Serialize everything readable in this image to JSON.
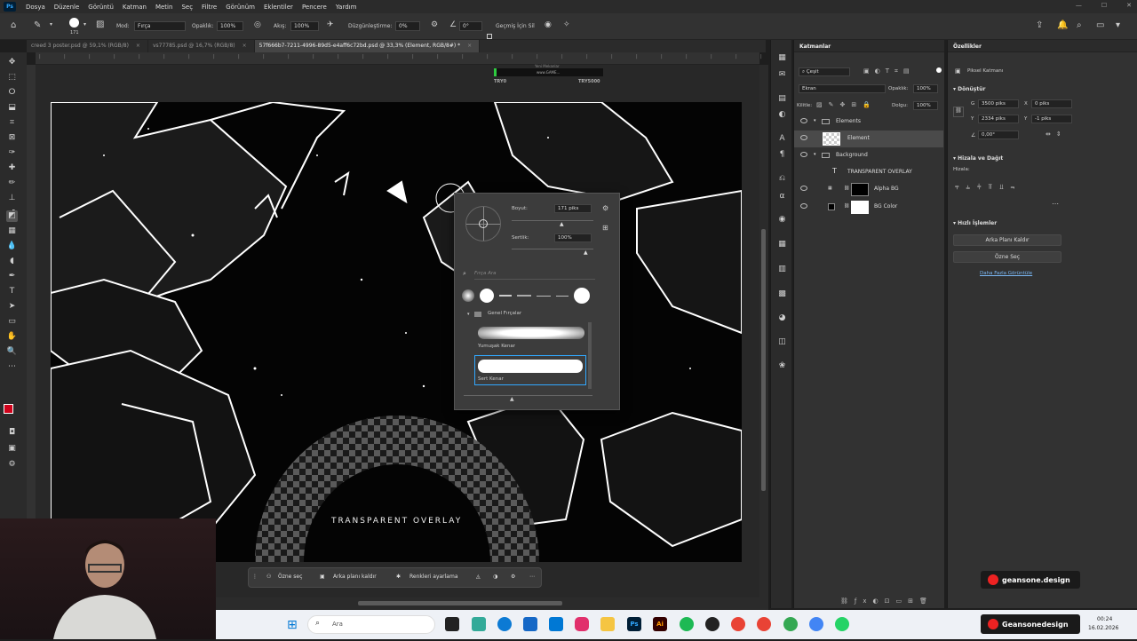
{
  "app": {
    "logo": "Ps"
  },
  "menu": [
    "Dosya",
    "Düzenle",
    "Görüntü",
    "Katman",
    "Metin",
    "Seç",
    "Filtre",
    "Görünüm",
    "Eklentiler",
    "Pencere",
    "Yardım"
  ],
  "options": {
    "brush_size": "171",
    "mode_label": "Mod:",
    "mode_value": "Fırça",
    "opacity_label": "Opaklık:",
    "opacity_value": "100%",
    "flow_label": "Akış:",
    "flow_value": "100%",
    "smoothing_label": "Düzgünleştirme:",
    "smoothing_value": "0%",
    "angle_value": "0°",
    "erase_history_label": "Geçmiş İçin Sil"
  },
  "tabs": [
    {
      "label": "creed 3 poster.psd @ 59,1% (RGB/8)",
      "close": "×"
    },
    {
      "label": "vs77785.psd @ 16,7% (RGB/8)",
      "close": "×"
    },
    {
      "label": "57f666b7-7211-4996-89d5-e4aff6c72bd.psd @ 33,3% (Element, RGB/8#) *",
      "close": "×"
    }
  ],
  "canvas": {
    "overlay_text": "TRANSPARENT OVERLAY",
    "top_label": "TRY0",
    "top_label2": "TRY5000",
    "top_caption": "Yeni Mekanlar",
    "top_caption2": "www.GAME..."
  },
  "brush_popup": {
    "size_label": "Boyut:",
    "size_value": "171 piks",
    "hardness_label": "Sertlik:",
    "hardness_value": "100%",
    "search_placeholder": "Fırça Ara",
    "group_label": "Genel Fırçalar",
    "brush1": "Yumuşak Kenar",
    "brush2": "Sert Kenar"
  },
  "context_bar": {
    "select_subject": "Özne seç",
    "remove_bg": "Arka planı kaldır",
    "color_adjust": "Renkleri ayarlama"
  },
  "layers_panel": {
    "title": "Katmanlar",
    "filter_label": "Çeşit",
    "blend_mode": "Ekran",
    "opacity_label": "Opaklık:",
    "opacity_value": "100%",
    "lock_label": "Kilitle:",
    "fill_label": "Dolgu:",
    "fill_value": "100%",
    "layers": [
      {
        "name": "Elements",
        "type": "group"
      },
      {
        "name": "Element",
        "type": "layer"
      },
      {
        "name": "Background",
        "type": "group"
      },
      {
        "name": "TRANSPARENT OVERLAY",
        "type": "text"
      },
      {
        "name": "Alpha BG",
        "type": "layer"
      },
      {
        "name": "BG Color",
        "type": "layer"
      }
    ]
  },
  "properties_panel": {
    "title": "Özellikler",
    "pixel_layer": "Piksel Katmanı",
    "transform": "Dönüştür",
    "w_label": "G",
    "w_value": "3500 piks",
    "h_label": "Y",
    "h_value": "2334 piks",
    "x_label": "X",
    "x_value": "0 piks",
    "y_label": "Y",
    "y_value": "-1 piks",
    "angle_value": "0,00°",
    "align_title": "Hizala ve Dağıt",
    "align_label": "Hizala:",
    "quick_actions": "Hızlı İşlemler",
    "remove_bg_btn": "Arka Planı Kaldır",
    "select_subject_btn": "Özne Seç",
    "more_link": "Daha Fazla Görüntüle"
  },
  "watermark": "geansone.design",
  "taskbar": {
    "search_placeholder": "Ara",
    "app_label": "Geansonedesign",
    "time": "00:24",
    "date": "16.02.2026"
  },
  "colors": {
    "accent": "#31a8ff",
    "foreground": "#d0021b",
    "background_color": "#7a1a8c"
  }
}
